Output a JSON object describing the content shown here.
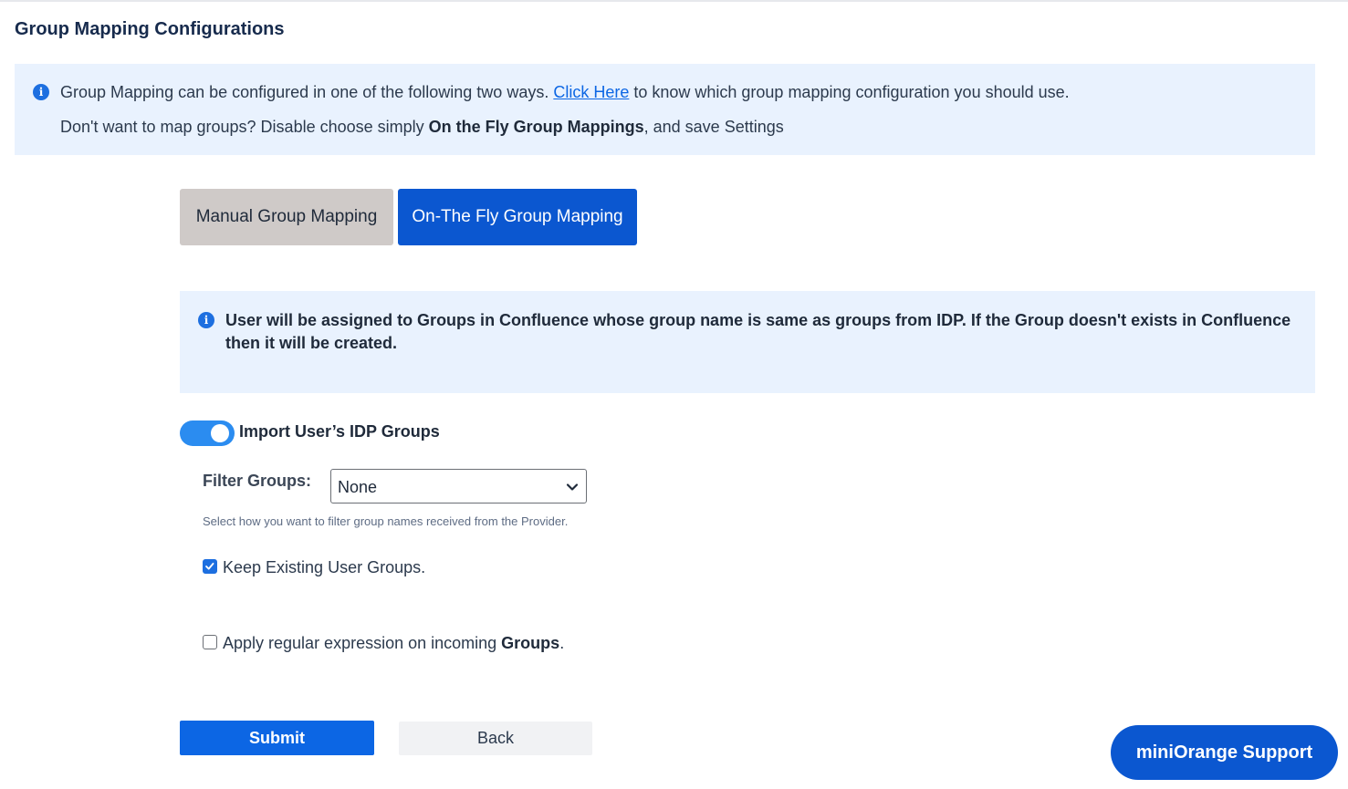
{
  "page": {
    "title": "Group Mapping Configurations"
  },
  "info_banner": {
    "line1_prefix": "Group Mapping can be configured in one of the following two ways. ",
    "line1_link": "Click Here",
    "line1_suffix": " to know which group mapping configuration you should use.",
    "line2_prefix": "Don't want to map groups? Disable choose simply ",
    "line2_bold": "On the Fly Group Mappings",
    "line2_suffix": ", and save Settings"
  },
  "tabs": {
    "manual_label": "Manual Group Mapping",
    "fly_label": "On-The Fly Group Mapping",
    "active": "On-The Fly Group Mapping"
  },
  "note": {
    "text": "User will be assigned to Groups in Confluence whose group name is same as groups from IDP. If the Group doesn't exists in Confluence then it will be created."
  },
  "import_toggle": {
    "label": "Import User’s IDP Groups",
    "enabled": true
  },
  "filter": {
    "label": "Filter Groups:",
    "selected": "None",
    "help": "Select how you want to filter group names received from the Provider."
  },
  "keep_existing": {
    "label": "Keep Existing User Groups.",
    "checked": true
  },
  "regex": {
    "label_prefix": "Apply regular expression on incoming ",
    "label_bold": "Groups",
    "label_suffix": ".",
    "checked": false
  },
  "actions": {
    "submit_label": "Submit",
    "back_label": "Back"
  },
  "support": {
    "label": "miniOrange Support"
  },
  "colors": {
    "primary": "#0c66e4",
    "tab_active": "#0b57d0",
    "tab_inactive": "#cfcac8",
    "banner_bg": "#e9f2fe",
    "toggle_on": "#2b8cf0"
  }
}
